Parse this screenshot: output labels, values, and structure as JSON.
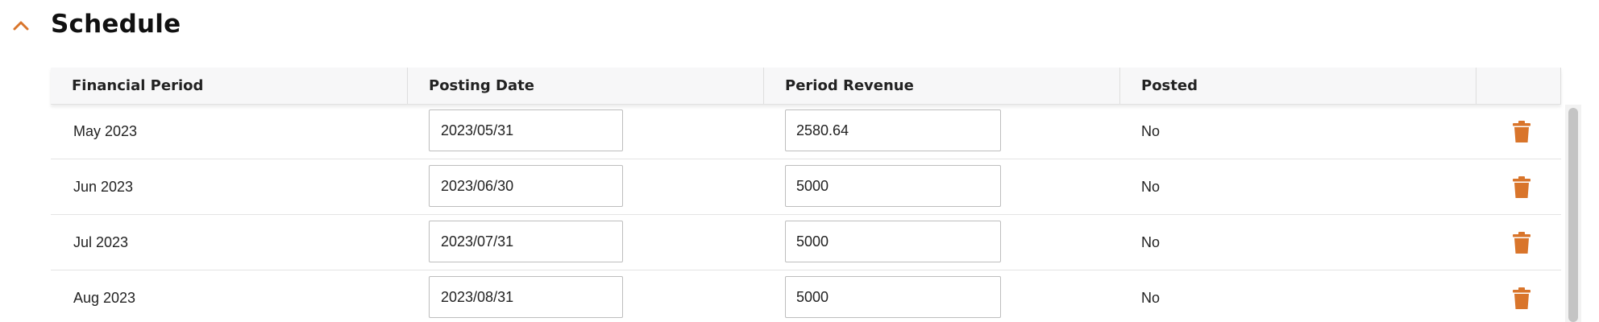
{
  "section": {
    "title": "Schedule",
    "toggle_icon": "chevron-up-icon",
    "accent_color": "#d9752b"
  },
  "table": {
    "columns": [
      "Financial Period",
      "Posting Date",
      "Period Revenue",
      "Posted",
      ""
    ],
    "rows": [
      {
        "period": "May 2023",
        "posting_date": "2023/05/31",
        "revenue": "2580.64",
        "posted": "No",
        "action_icon": "trash-icon"
      },
      {
        "period": "Jun 2023",
        "posting_date": "2023/06/30",
        "revenue": "5000",
        "posted": "No",
        "action_icon": "trash-icon"
      },
      {
        "period": "Jul 2023",
        "posting_date": "2023/07/31",
        "revenue": "5000",
        "posted": "No",
        "action_icon": "trash-icon"
      },
      {
        "period": "Aug 2023",
        "posting_date": "2023/08/31",
        "revenue": "5000",
        "posted": "No",
        "action_icon": "trash-icon"
      }
    ]
  }
}
